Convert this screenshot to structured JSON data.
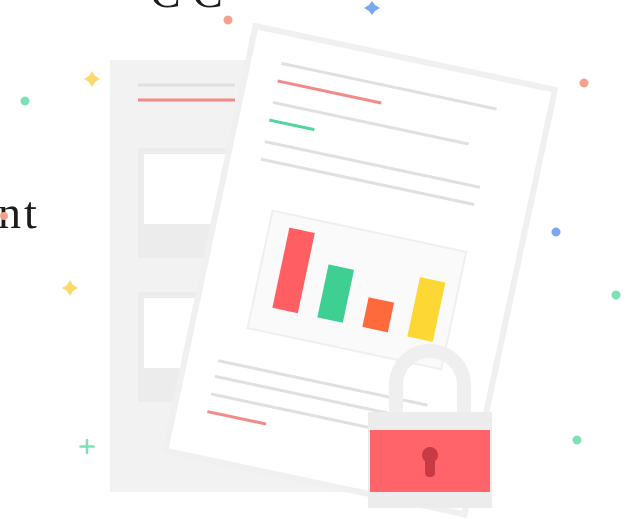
{
  "illustration": {
    "icon": "secure-document-illustration",
    "colors": {
      "back_page": "#f2f2f2",
      "front_page": "#ffffff",
      "line_gray": "#e0e0e0",
      "accent_red": "#f28b88",
      "accent_green": "#4fd69c",
      "bar_red": "#ff5f63",
      "bar_green": "#3ecf93",
      "bar_orange": "#ff6a3d",
      "bar_yellow": "#fdd835",
      "lock_body": "#ff646a",
      "lock_shackle": "#ededed",
      "keyhole": "#c93b44"
    },
    "bar_levels": [
      1.0,
      0.66,
      0.37,
      0.74
    ]
  },
  "cropped_text": {
    "left": "nt",
    "top": "C C"
  }
}
